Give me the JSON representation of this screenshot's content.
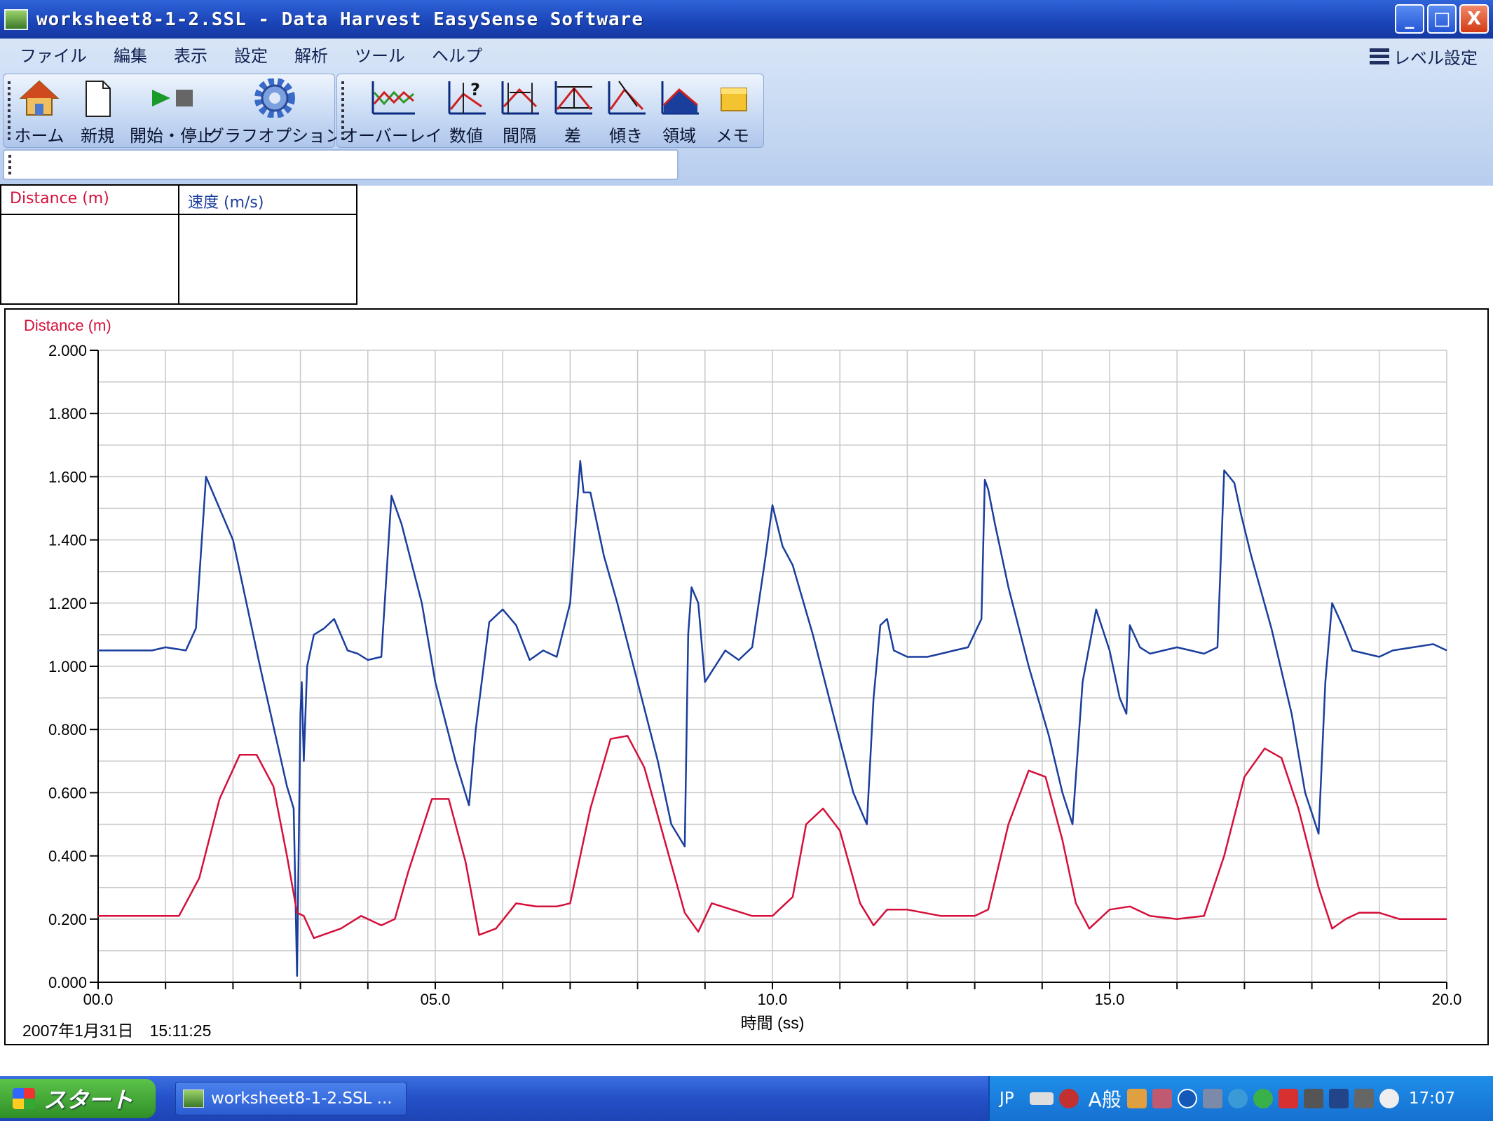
{
  "window": {
    "title": "worksheet8-1-2.SSL - Data Harvest EasySense Software",
    "controls": [
      "_",
      "□",
      "X"
    ]
  },
  "menu": [
    "ファイル",
    "編集",
    "表示",
    "設定",
    "解析",
    "ツール",
    "ヘルプ"
  ],
  "level_setting": "レベル設定",
  "toolbar1": [
    {
      "label": "ホーム",
      "icon": "home-icon"
    },
    {
      "label": "新規",
      "icon": "new-document-icon"
    },
    {
      "label": "開始・停止",
      "icon": "play-stop-icon"
    },
    {
      "label": "グラフオプション",
      "icon": "gear-icon"
    }
  ],
  "toolbar2": [
    {
      "label": "オーバーレイ",
      "icon": "overlay-icon"
    },
    {
      "label": "数値",
      "icon": "values-icon"
    },
    {
      "label": "間隔",
      "icon": "interval-icon"
    },
    {
      "label": "差",
      "icon": "difference-icon"
    },
    {
      "label": "傾き",
      "icon": "gradient-icon"
    },
    {
      "label": "領域",
      "icon": "area-icon"
    },
    {
      "label": "メモ",
      "icon": "memo-icon"
    }
  ],
  "data_table": {
    "columns": [
      {
        "header": "Distance (m)",
        "color": "#d4103a"
      },
      {
        "header": "速度 (m/s)",
        "color": "#1a3e9c"
      }
    ]
  },
  "graph": {
    "timestamp": "2007年1月31日　15:11:25"
  },
  "chart_data": {
    "type": "line",
    "ylabel": "Distance (m)",
    "xlabel": "時間 (ss)",
    "xlim": [
      0,
      20
    ],
    "ylim": [
      0,
      2
    ],
    "x_ticks": [
      "00.0",
      "05.0",
      "10.0",
      "15.0",
      "20.0"
    ],
    "y_ticks": [
      "0.000",
      "0.200",
      "0.400",
      "0.600",
      "0.800",
      "1.000",
      "1.200",
      "1.400",
      "1.600",
      "1.800",
      "2.000"
    ],
    "grid": true,
    "series": [
      {
        "color": "#1a3e9c",
        "x": [
          0,
          0.8,
          1.0,
          1.3,
          1.45,
          1.6,
          2.0,
          2.4,
          2.8,
          2.9,
          2.95,
          3.0,
          3.02,
          3.05,
          3.1,
          3.2,
          3.35,
          3.5,
          3.7,
          3.85,
          4.0,
          4.2,
          4.35,
          4.5,
          4.8,
          5.0,
          5.3,
          5.5,
          5.6,
          5.8,
          6.0,
          6.2,
          6.4,
          6.6,
          6.8,
          7.0,
          7.15,
          7.2,
          7.3,
          7.5,
          7.7,
          8.0,
          8.3,
          8.5,
          8.7,
          8.75,
          8.8,
          8.9,
          9.0,
          9.15,
          9.3,
          9.5,
          9.7,
          9.9,
          10.0,
          10.15,
          10.3,
          10.6,
          10.9,
          11.2,
          11.4,
          11.5,
          11.6,
          11.7,
          11.8,
          12.0,
          12.3,
          12.5,
          12.7,
          12.9,
          13.1,
          13.15,
          13.2,
          13.3,
          13.5,
          13.8,
          14.1,
          14.3,
          14.45,
          14.6,
          14.8,
          15.0,
          15.15,
          15.25,
          15.3,
          15.45,
          15.6,
          15.8,
          16.0,
          16.2,
          16.4,
          16.6,
          16.7,
          16.85,
          16.95,
          17.1,
          17.4,
          17.7,
          17.9,
          18.1,
          18.2,
          18.3,
          18.45,
          18.6,
          18.8,
          19.0,
          19.2,
          19.5,
          19.8,
          20.0
        ],
        "y": [
          1.05,
          1.05,
          1.06,
          1.05,
          1.12,
          1.6,
          1.4,
          1.0,
          0.62,
          0.55,
          0.02,
          0.85,
          0.95,
          0.7,
          1.0,
          1.1,
          1.12,
          1.15,
          1.05,
          1.04,
          1.02,
          1.03,
          1.54,
          1.45,
          1.2,
          0.95,
          0.7,
          0.56,
          0.8,
          1.14,
          1.18,
          1.13,
          1.02,
          1.05,
          1.03,
          1.2,
          1.65,
          1.55,
          1.55,
          1.35,
          1.2,
          0.95,
          0.7,
          0.5,
          0.43,
          1.1,
          1.25,
          1.2,
          0.95,
          1.0,
          1.05,
          1.02,
          1.06,
          1.35,
          1.51,
          1.38,
          1.32,
          1.1,
          0.85,
          0.6,
          0.5,
          0.9,
          1.13,
          1.15,
          1.05,
          1.03,
          1.03,
          1.04,
          1.05,
          1.06,
          1.15,
          1.59,
          1.56,
          1.45,
          1.25,
          1.0,
          0.78,
          0.6,
          0.5,
          0.95,
          1.18,
          1.05,
          0.9,
          0.85,
          1.13,
          1.06,
          1.04,
          1.05,
          1.06,
          1.05,
          1.04,
          1.06,
          1.62,
          1.58,
          1.48,
          1.35,
          1.12,
          0.85,
          0.6,
          0.47,
          0.95,
          1.2,
          1.13,
          1.05,
          1.04,
          1.03,
          1.05,
          1.06,
          1.07,
          1.05
        ]
      },
      {
        "color": "#d4103a",
        "x": [
          0,
          0.8,
          1.2,
          1.5,
          1.8,
          2.1,
          2.35,
          2.6,
          2.8,
          2.95,
          3.05,
          3.2,
          3.6,
          3.9,
          4.2,
          4.4,
          4.6,
          4.95,
          5.2,
          5.45,
          5.65,
          5.9,
          6.2,
          6.5,
          6.8,
          7.0,
          7.3,
          7.6,
          7.85,
          8.1,
          8.4,
          8.7,
          8.9,
          9.1,
          9.4,
          9.7,
          10.0,
          10.3,
          10.5,
          10.75,
          11.0,
          11.3,
          11.5,
          11.7,
          12.0,
          12.5,
          13.0,
          13.2,
          13.5,
          13.8,
          14.05,
          14.3,
          14.5,
          14.7,
          15.0,
          15.3,
          15.6,
          16.0,
          16.4,
          16.7,
          17.0,
          17.3,
          17.55,
          17.8,
          18.1,
          18.3,
          18.5,
          18.7,
          19.0,
          19.3,
          19.6,
          20.0
        ],
        "y": [
          0.21,
          0.21,
          0.21,
          0.33,
          0.58,
          0.72,
          0.72,
          0.62,
          0.4,
          0.22,
          0.21,
          0.14,
          0.17,
          0.21,
          0.18,
          0.2,
          0.35,
          0.58,
          0.58,
          0.38,
          0.15,
          0.17,
          0.25,
          0.24,
          0.24,
          0.25,
          0.55,
          0.77,
          0.78,
          0.68,
          0.45,
          0.22,
          0.16,
          0.25,
          0.23,
          0.21,
          0.21,
          0.27,
          0.5,
          0.55,
          0.48,
          0.25,
          0.18,
          0.23,
          0.23,
          0.21,
          0.21,
          0.23,
          0.5,
          0.67,
          0.65,
          0.45,
          0.25,
          0.17,
          0.23,
          0.24,
          0.21,
          0.2,
          0.21,
          0.4,
          0.65,
          0.74,
          0.71,
          0.55,
          0.3,
          0.17,
          0.2,
          0.22,
          0.22,
          0.2,
          0.2,
          0.2
        ]
      }
    ]
  },
  "taskbar": {
    "start": "スタート",
    "task": "worksheet8-1-2.SSL ...",
    "lang": "JP",
    "ime": "A般",
    "clock": "17:07"
  }
}
